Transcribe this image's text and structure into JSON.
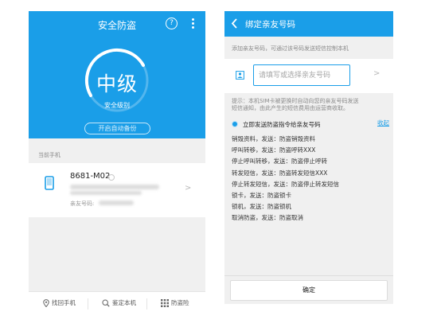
{
  "left_screen": {
    "header": {
      "title": "安全防盗",
      "help_icon": "question-circle-icon",
      "more_icon": "more-vertical-icon",
      "accent_color": "#1a9ee8"
    },
    "security": {
      "level": "中级",
      "level_label": "安全级别",
      "backup_button": "开启自动备份"
    },
    "section_label": "当前手机",
    "device": {
      "icon": "phone-icon",
      "name": "8681-M02",
      "friend_label": "亲友号码:"
    },
    "bottom_nav": [
      {
        "icon": "location-icon",
        "label": "找回手机"
      },
      {
        "icon": "search-icon",
        "label": "鉴定本机"
      },
      {
        "icon": "grid-icon",
        "label": "防盗险"
      }
    ]
  },
  "right_screen": {
    "header": {
      "back_icon": "chevron-left-icon",
      "title": "绑定亲友号码"
    },
    "add_note": "添加亲友号码，可通过该号码发送短信控制本机",
    "input": {
      "icon": "contact-card-icon",
      "placeholder": "请填写或选择亲友号码",
      "value": ""
    },
    "tip_line1": "提示：本机SIM卡被更换时自动向您的亲友号码发送",
    "tip_line2": "短信通知，由此产生的短信费用由运营商收取。",
    "send_option": {
      "label": "立即发送防盗指令给亲友号码",
      "collapse_link": "收起"
    },
    "commands": [
      "销毁资料，发送：防盗销毁资料",
      "呼叫转移，发送：防盗呼转XXX",
      "停止呼叫转移，发送：防盗停止呼转",
      "转发短信，发送：防盗转发短信XXX",
      "停止转发短信，发送：防盗停止转发短信",
      "锁卡，发送：防盗锁卡",
      "锁机，发送：防盗锁机",
      "取消防盗，发送：防盗取消"
    ],
    "confirm_button": "确定"
  }
}
